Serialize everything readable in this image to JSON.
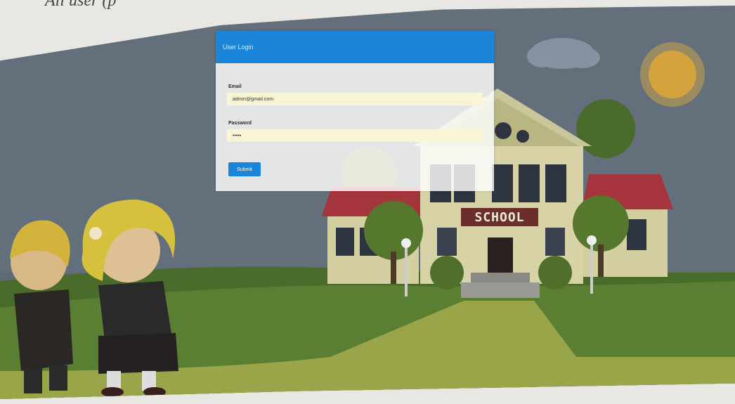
{
  "page": {
    "caption_fragment": "All user (p"
  },
  "login": {
    "title": "User Login",
    "email_label": "Email",
    "email_value": "admin@gmail.com",
    "password_label": "Password",
    "password_value": "•••••",
    "submit_label": "Submit"
  },
  "scene": {
    "sign_text": "SCHOOL"
  },
  "colors": {
    "header_blue": "#1b86d9",
    "input_fill": "#f8f6d2",
    "grass": "#5f8a31",
    "roof": "#a6343d"
  }
}
